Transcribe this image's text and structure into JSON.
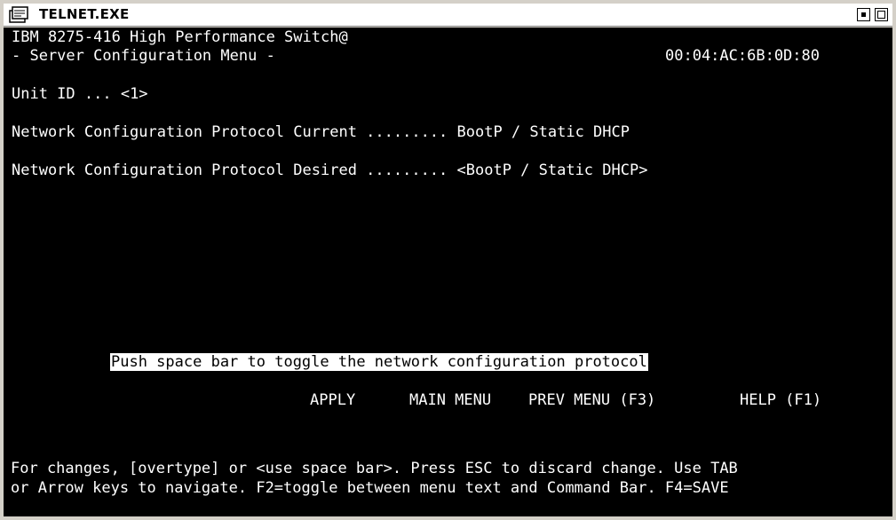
{
  "window": {
    "title": "TELNET.EXE"
  },
  "terminal": {
    "header_line1": "IBM 8275-416 High Performance Switch@",
    "header_line2": "- Server Configuration Menu -",
    "mac_address": "00:04:AC:6B:0D:80",
    "unit_id_label": "Unit ID ... ",
    "unit_id_value": "<1>",
    "protocol_current_label": "Network Configuration Protocol Current ......... ",
    "protocol_current_value": "BootP / Static DHCP",
    "protocol_desired_label": "Network Configuration Protocol Desired ......... ",
    "protocol_desired_value": "<BootP / Static DHCP>",
    "hint": "Push space bar to toggle the network configuration protocol",
    "commands": {
      "apply": "APPLY",
      "main_menu": "MAIN MENU",
      "prev_menu": "PREV MENU (F3)",
      "help": "HELP (F1)"
    },
    "footer_line1": "For changes, [overtype] or <use space bar>. Press ESC to discard change. Use TAB",
    "footer_line2": "or Arrow keys to navigate. F2=toggle between menu text and Command Bar. F4=SAVE"
  }
}
